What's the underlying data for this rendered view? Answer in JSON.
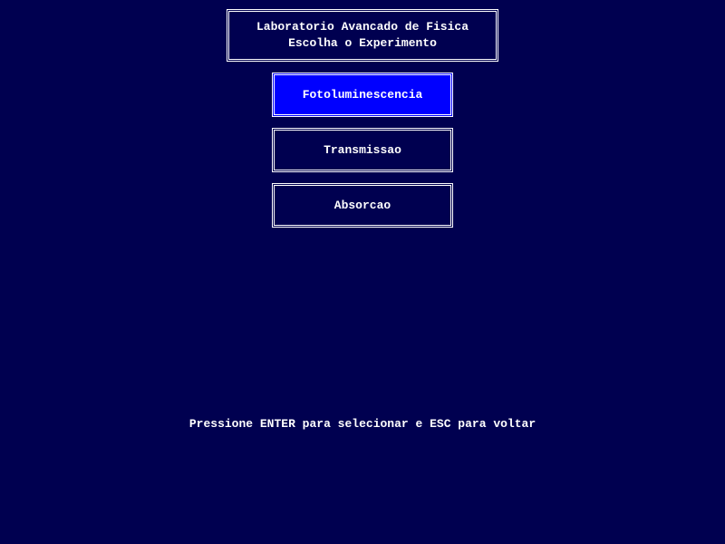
{
  "header": {
    "line1": "Laboratorio Avancado de Fisica",
    "line2": "Escolha o Experimento"
  },
  "menu": {
    "items": [
      {
        "label": "Fotoluminescencia",
        "selected": true
      },
      {
        "label": "Transmissao",
        "selected": false
      },
      {
        "label": "Absorcao",
        "selected": false
      }
    ]
  },
  "footer": {
    "hint": "Pressione ENTER para selecionar e ESC para voltar"
  },
  "colors": {
    "background": "#000050",
    "text": "#ffffff",
    "selected": "#0000ff"
  }
}
